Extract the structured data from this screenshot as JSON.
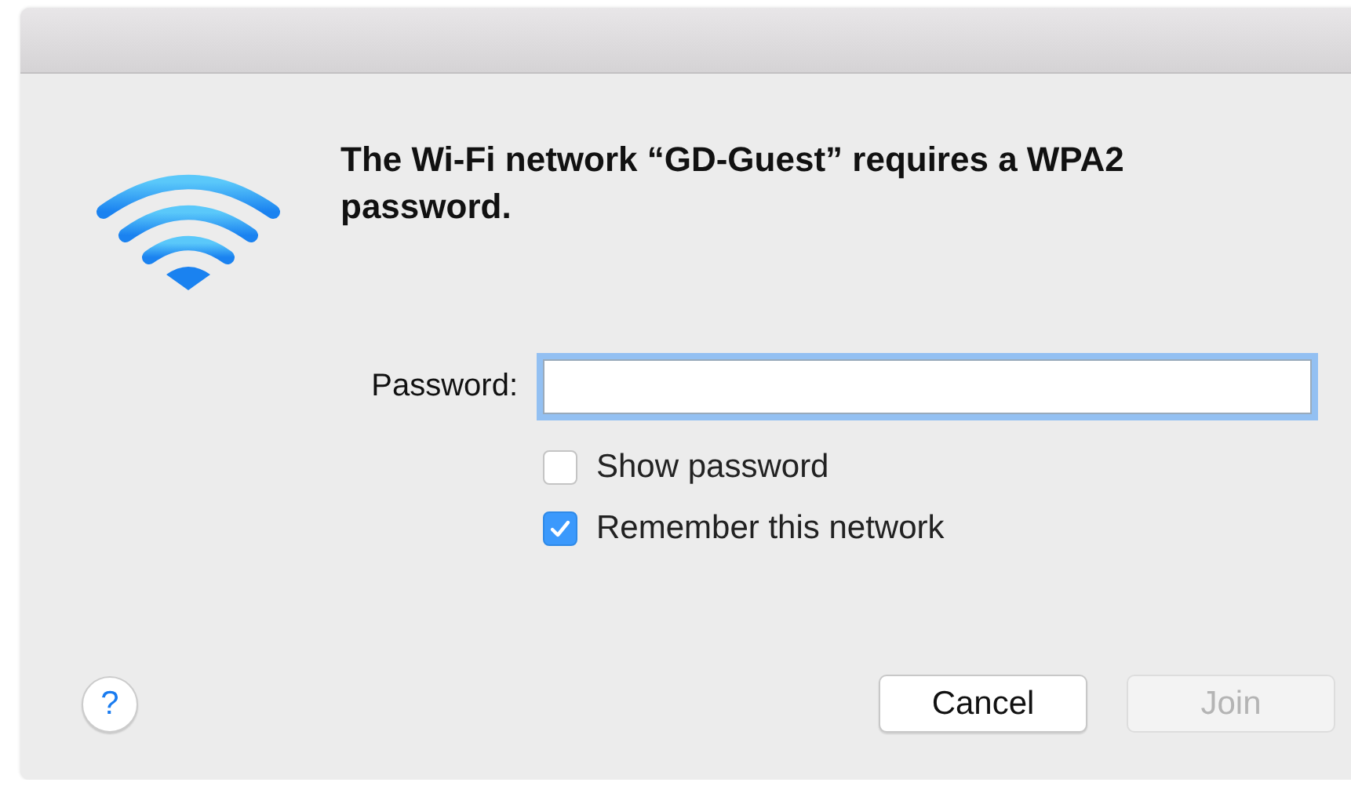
{
  "message": "The Wi-Fi network “GD-Guest” requires a WPA2 password.",
  "password": {
    "label": "Password:",
    "focused": true
  },
  "options": [
    {
      "label": "Show password",
      "checked": false
    },
    {
      "label": "Remember this network",
      "checked": true
    }
  ],
  "help": {
    "label": "?"
  },
  "buttons": [
    {
      "label": "Cancel",
      "disabled": false
    },
    {
      "label": "Join",
      "disabled": true
    }
  ]
}
